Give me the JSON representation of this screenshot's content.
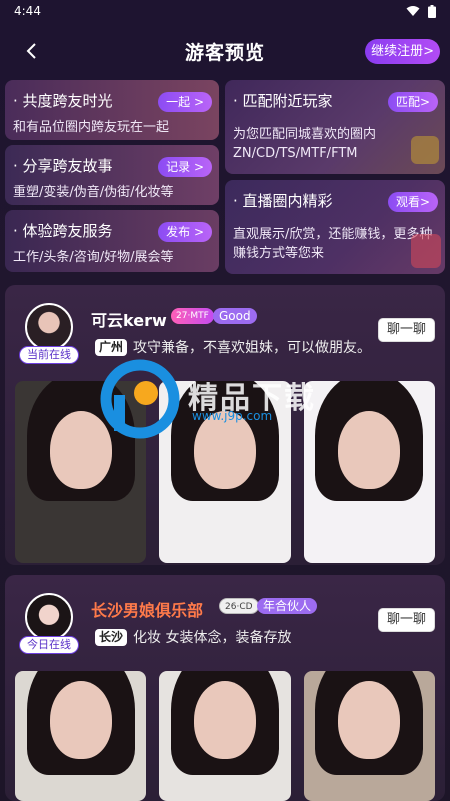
{
  "status": {
    "time": "4:44"
  },
  "header": {
    "title": "游客预览",
    "register_label": "继续注册>"
  },
  "cards": [
    {
      "title": "· 共度跨友时光",
      "desc": "和有品位圈内跨友玩在一起",
      "button": "一起 >"
    },
    {
      "title": "· 分享跨友故事",
      "desc": "重塑/变装/伪音/伪街/化妆等",
      "button": "记录 >"
    },
    {
      "title": "· 体验跨友服务",
      "desc": "工作/头条/咨询/好物/展会等",
      "button": "发布 >"
    },
    {
      "title": "· 匹配附近玩家",
      "desc": "为您匹配同城喜欢的圈内ZN/CD/TS/MTF/FTM",
      "button": "匹配>"
    },
    {
      "title": "· 直播圈内精彩",
      "desc": "直观展示/欣赏，还能赚钱，更多种赚钱方式等您来",
      "button": "观看>"
    }
  ],
  "posts": [
    {
      "name": "可云kerw",
      "tag1": "27·MTF",
      "tag2": "Good",
      "online": "当前在线",
      "location": "广州",
      "text": "攻守兼备，不喜欢姐妹，可以做朋友。",
      "chat": "聊一聊"
    },
    {
      "name": "长沙男娘俱乐部",
      "tag1": "26·CD",
      "tag2": "年合伙人",
      "online": "今日在线",
      "location": "长沙",
      "text": "化妆 女装体念，装备存放",
      "chat": "聊一聊"
    }
  ],
  "watermark": {
    "brand": "精品下载",
    "url": "www.j9p.com"
  }
}
